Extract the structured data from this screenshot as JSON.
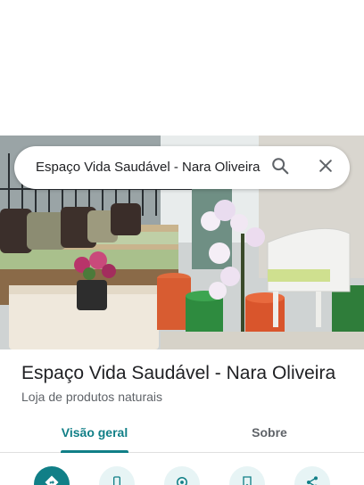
{
  "search": {
    "query": "Espaço Vida Saudável - Nara Oliveira",
    "search_icon": "search-icon",
    "close_icon": "close-icon"
  },
  "place": {
    "name": "Espaço Vida Saudável - Nara Oliveira",
    "category": "Loja de produtos naturais"
  },
  "tabs": [
    {
      "label": "Visão geral",
      "selected": true
    },
    {
      "label": "Sobre",
      "selected": false
    }
  ],
  "actions": [
    {
      "icon": "directions-icon",
      "primary": true
    },
    {
      "icon": "call-icon",
      "primary": false
    },
    {
      "icon": "nearby-icon",
      "primary": false
    },
    {
      "icon": "save-icon",
      "primary": false
    },
    {
      "icon": "share-icon",
      "primary": false
    }
  ],
  "colors": {
    "accent": "#117f87",
    "accent_light": "#e7f4f5",
    "text_primary": "#202124",
    "text_secondary": "#5f6368"
  }
}
